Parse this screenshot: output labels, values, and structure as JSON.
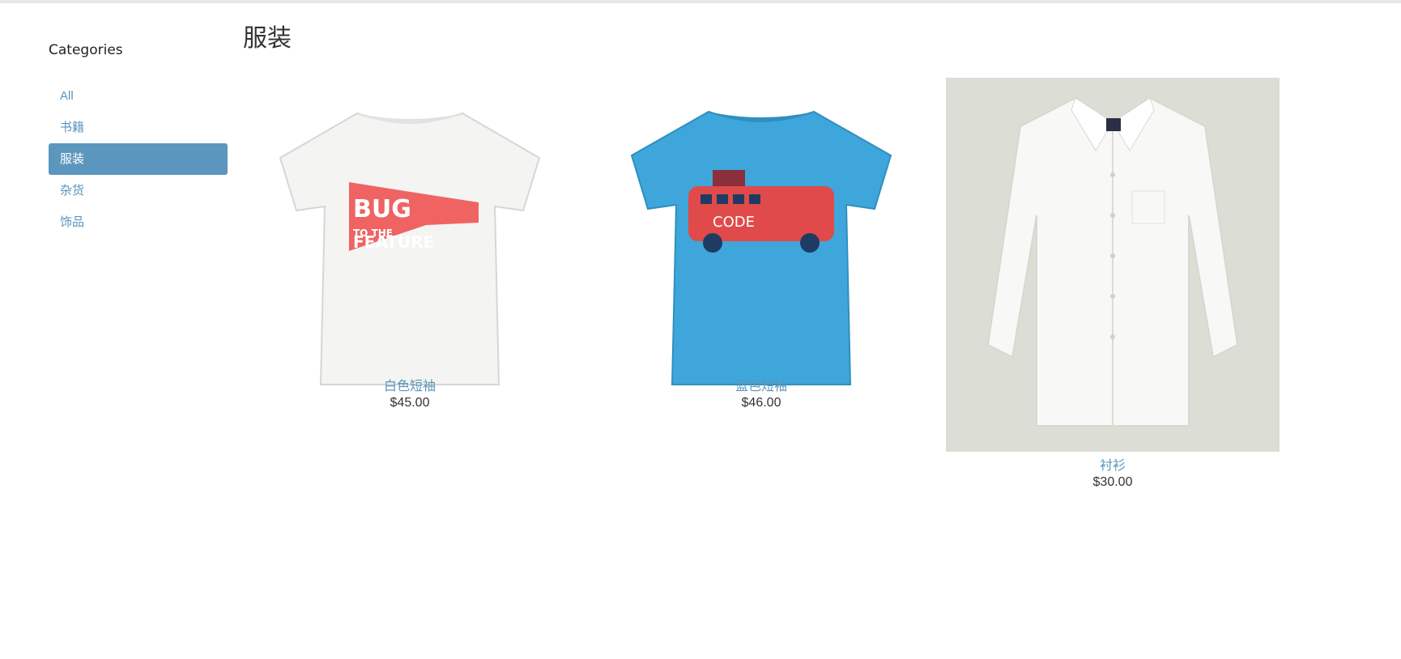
{
  "sidebar": {
    "title": "Categories",
    "items": [
      {
        "label": "All",
        "active": false
      },
      {
        "label": "书籍",
        "active": false
      },
      {
        "label": "服装",
        "active": true
      },
      {
        "label": "杂货",
        "active": false
      },
      {
        "label": "饰品",
        "active": false
      }
    ]
  },
  "main": {
    "title": "服装",
    "products": [
      {
        "name": "白色短袖",
        "price": "$45.00",
        "image": "white-tshirt-bug-to-the-feature",
        "image_text": [
          "BUG",
          "TO THE",
          "FEATURE"
        ]
      },
      {
        "name": "蓝色短袖",
        "price": "$46.00",
        "image": "blue-tshirt-van-code",
        "image_text": [
          "CODE"
        ]
      },
      {
        "name": "衬衫",
        "price": "$30.00",
        "image": "white-shirt"
      }
    ]
  },
  "colors": {
    "accent": "#5b96be",
    "link": "#5a95bd",
    "text": "#333333",
    "tee_blue": "#3ea6da",
    "print_red": "#ee5b5b"
  }
}
